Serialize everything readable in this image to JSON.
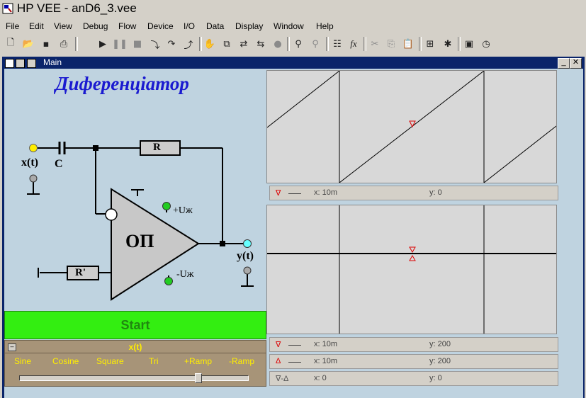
{
  "app": {
    "title": "HP VEE - anD6_3.vee"
  },
  "menu": [
    "File",
    "Edit",
    "View",
    "Debug",
    "Flow",
    "Device",
    "I/O",
    "Data",
    "Display",
    "Window",
    "Help"
  ],
  "toolbar": {
    "icons": [
      "new-icon",
      "open-icon",
      "save-icon",
      "print-icon",
      "run-icon",
      "pause-icon",
      "stop-icon",
      "step-into-icon",
      "step-over-icon",
      "step-out-icon",
      "hand-icon",
      "container-icon",
      "connect-icon",
      "connect-alt-icon",
      "bulb-icon",
      "find-icon",
      "find-alt-icon",
      "properties-icon",
      "function-icon",
      "cut-icon",
      "copy-icon",
      "paste-icon",
      "group-icon",
      "debug-icon",
      "panel-icon",
      "timer-icon"
    ]
  },
  "window": {
    "title": "Main"
  },
  "circuit": {
    "heading": "Диференціатор",
    "input_label": "x(t)",
    "capacitor_label": "C",
    "resistor_label": "R",
    "opamp_label": "ОП",
    "vplus_label": "+Uж",
    "vminus_label": "-Uж",
    "output_label": "y(t)",
    "ground_resistor_label": "R'"
  },
  "start_button": {
    "label": "Start"
  },
  "func_selector": {
    "title": "x(t)",
    "options": [
      "Sine",
      "Cosine",
      "Square",
      "Tri",
      "+Ramp",
      "-Ramp"
    ],
    "selected": "+Ramp"
  },
  "display1": {
    "marker": {
      "x": "x: 10m",
      "y": "y: 0"
    }
  },
  "display2": {
    "marker1": {
      "x": "x: 10m",
      "y": "y: 200"
    },
    "marker2": {
      "x": "x: 10m",
      "y": "y: 200"
    },
    "delta": {
      "label": "∇-Δ",
      "x": "x: 0",
      "y": "y: 0"
    }
  },
  "colors": {
    "accent_blue": "#0a246a",
    "start_green": "#33ee11",
    "input_yellow": "#ffee00",
    "output_cyan": "#66ffff",
    "supply_green": "#22cc22",
    "marker_red": "#dd0000"
  }
}
